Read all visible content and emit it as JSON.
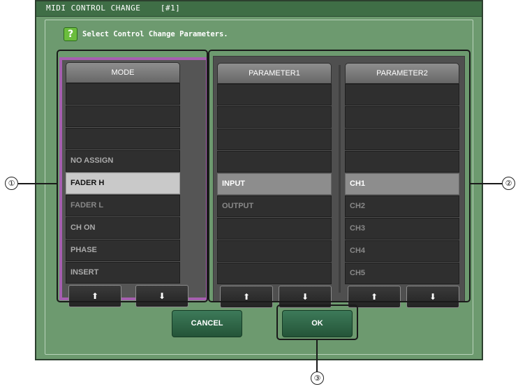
{
  "dialog": {
    "title": "MIDI CONTROL CHANGE    [#1]",
    "instruction": "Select Control Change Parameters.",
    "help_glyph": "?"
  },
  "columns": {
    "mode": {
      "header": "MODE",
      "rows": [
        "",
        "",
        "",
        "NO ASSIGN",
        "FADER H",
        "FADER L",
        "CH ON",
        "PHASE",
        "INSERT"
      ],
      "selected": "FADER H"
    },
    "parameter1": {
      "header": "PARAMETER1",
      "rows": [
        "",
        "",
        "",
        "",
        "INPUT",
        "OUTPUT",
        "",
        "",
        ""
      ],
      "selected": "INPUT"
    },
    "parameter2": {
      "header": "PARAMETER2",
      "rows": [
        "",
        "",
        "",
        "",
        "CH1",
        "CH2",
        "CH3",
        "CH4",
        "CH5"
      ],
      "selected": "CH1"
    }
  },
  "scroll": {
    "up_glyph": "⬆",
    "down_glyph": "⬇"
  },
  "buttons": {
    "cancel_label": "CANCEL",
    "ok_label": "OK"
  },
  "callouts": [
    "①",
    "②",
    "③"
  ],
  "colors": {
    "dialog_bg": "#6d9a6f",
    "mode_highlight": "#a65fb0",
    "row_selected": "#c9c9c9",
    "button_green": "#2f6a48"
  }
}
